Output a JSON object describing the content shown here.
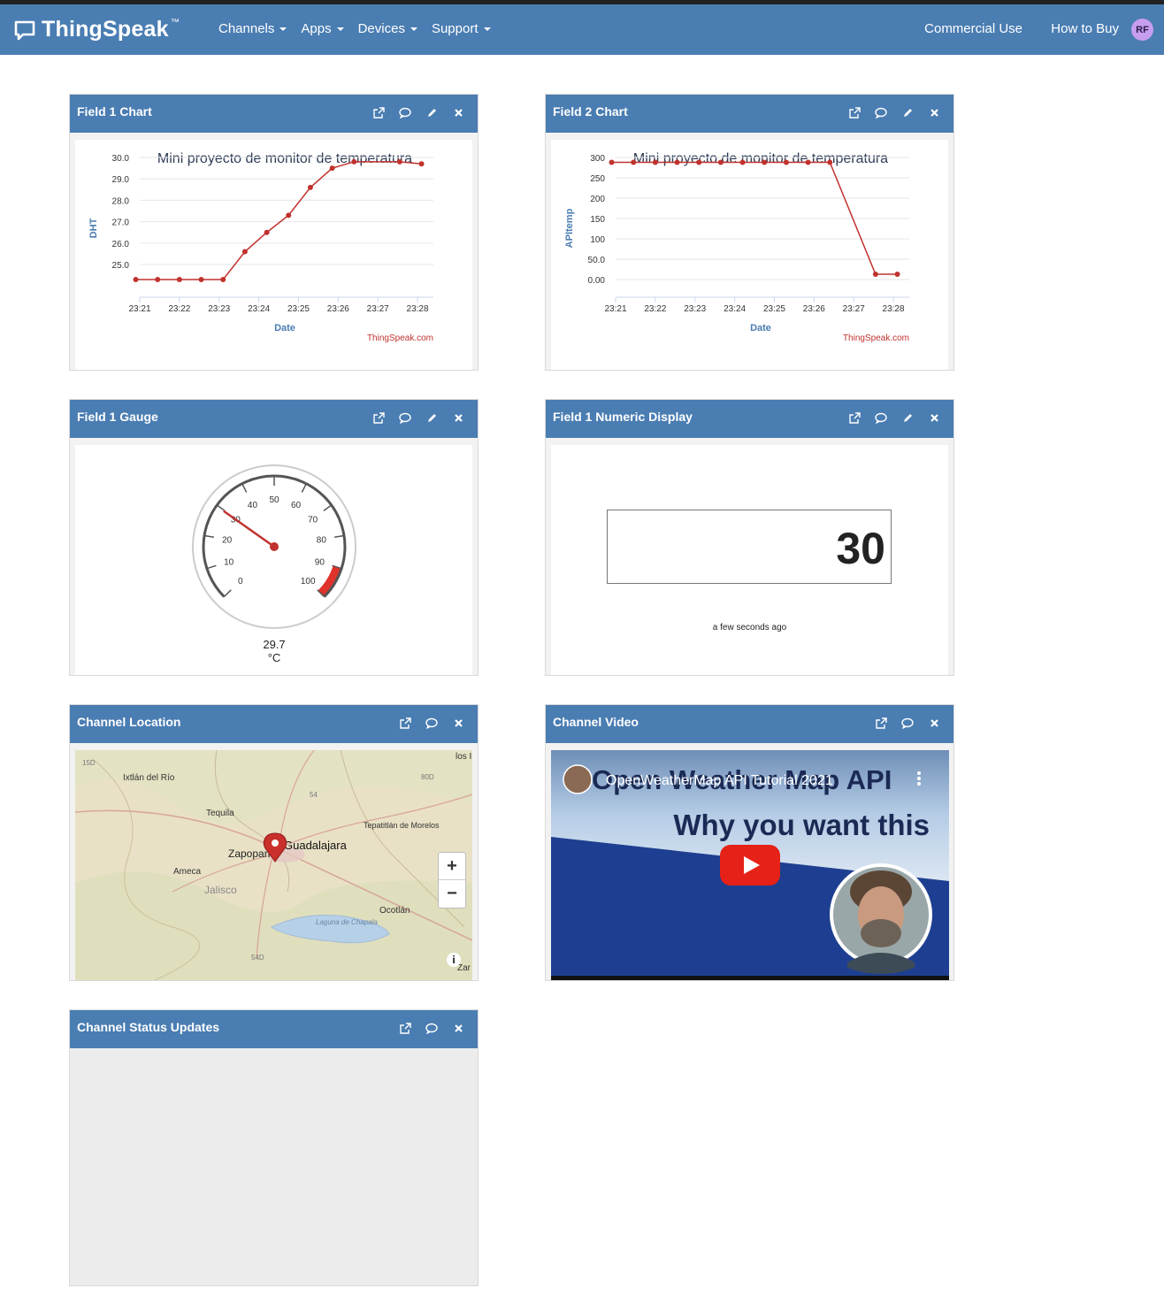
{
  "nav": {
    "brand": "ThingSpeak",
    "tm": "™",
    "left": [
      "Channels",
      "Apps",
      "Devices",
      "Support"
    ],
    "right": [
      "Commercial Use",
      "How to Buy"
    ],
    "avatar": "RF"
  },
  "colors": {
    "navbar": "#4a7db2",
    "series": "#c0322e",
    "avatar": "#c79ef0"
  },
  "panels": {
    "field1_chart": {
      "title": "Field 1 Chart"
    },
    "field2_chart": {
      "title": "Field 2 Chart"
    },
    "field1_gauge": {
      "title": "Field 1 Gauge"
    },
    "field1_numeric": {
      "title": "Field 1 Numeric Display"
    },
    "location": {
      "title": "Channel Location"
    },
    "video": {
      "title": "Channel Video"
    },
    "status": {
      "title": "Channel Status Updates"
    }
  },
  "chart_data": [
    {
      "type": "line",
      "title": "Mini proyecto de monitor de temperatura",
      "xlabel": "Date",
      "ylabel": "DHT",
      "credit": "ThingSpeak.com",
      "x_ticks": [
        "23:21",
        "23:22",
        "23:23",
        "23:24",
        "23:25",
        "23:26",
        "23:27",
        "23:28"
      ],
      "y_ticks": [
        "25.0",
        "26.0",
        "27.0",
        "28.0",
        "29.0",
        "30.0"
      ],
      "ylim": [
        24.3,
        30.0
      ],
      "xlim": [
        0,
        7.4
      ],
      "x": [
        -0.1,
        0.45,
        1.0,
        1.55,
        2.1,
        2.65,
        3.2,
        3.75,
        4.3,
        4.85,
        5.4,
        6.55,
        7.1
      ],
      "values": [
        24.3,
        24.3,
        24.3,
        24.3,
        24.3,
        25.6,
        26.5,
        27.3,
        28.6,
        29.5,
        29.8,
        29.8,
        29.7
      ]
    },
    {
      "type": "line",
      "title": "Mini proyecto de monitor de temperatura",
      "xlabel": "Date",
      "ylabel": "APItemp",
      "credit": "ThingSpeak.com",
      "x_ticks": [
        "23:21",
        "23:22",
        "23:23",
        "23:24",
        "23:25",
        "23:26",
        "23:27",
        "23:28"
      ],
      "y_ticks": [
        "0.00",
        "50.0",
        "100",
        "150",
        "200",
        "250",
        "300"
      ],
      "ylim": [
        0,
        300
      ],
      "xlim": [
        0,
        7.4
      ],
      "x": [
        -0.1,
        0.45,
        1.0,
        1.55,
        2.1,
        2.65,
        3.2,
        3.75,
        4.3,
        4.85,
        5.4,
        6.55,
        7.1
      ],
      "values": [
        288,
        288,
        288,
        288,
        288,
        288,
        288,
        288,
        288,
        288,
        288,
        13,
        13
      ]
    }
  ],
  "gauge": {
    "value": "29.7",
    "unit": "°C",
    "numeric_value": 29.7,
    "min": 0,
    "max": 100,
    "labels": [
      "0",
      "10",
      "20",
      "30",
      "40",
      "50",
      "60",
      "70",
      "80",
      "90",
      "100"
    ],
    "red_band": [
      90,
      100
    ]
  },
  "numeric": {
    "value": "30",
    "time": "a few seconds ago"
  },
  "map": {
    "labels": [
      "Ixtlán del Río",
      "Tequila",
      "Zapopan",
      "Guadalajara",
      "Tepatitlán de Morelos",
      "Ameca",
      "Jalisco",
      "Ocotlán",
      "Laguna de Chapala",
      "los I",
      "Zar"
    ],
    "road_labels": [
      "15D",
      "54",
      "80D",
      "54D"
    ],
    "zoom_in": "+",
    "zoom_out": "−",
    "info": "i"
  },
  "video": {
    "channel_title": "OpenWeatherMap API Tutorial 2021",
    "big_title": "Open Weather Map API",
    "subtitle": "Why you want this"
  }
}
